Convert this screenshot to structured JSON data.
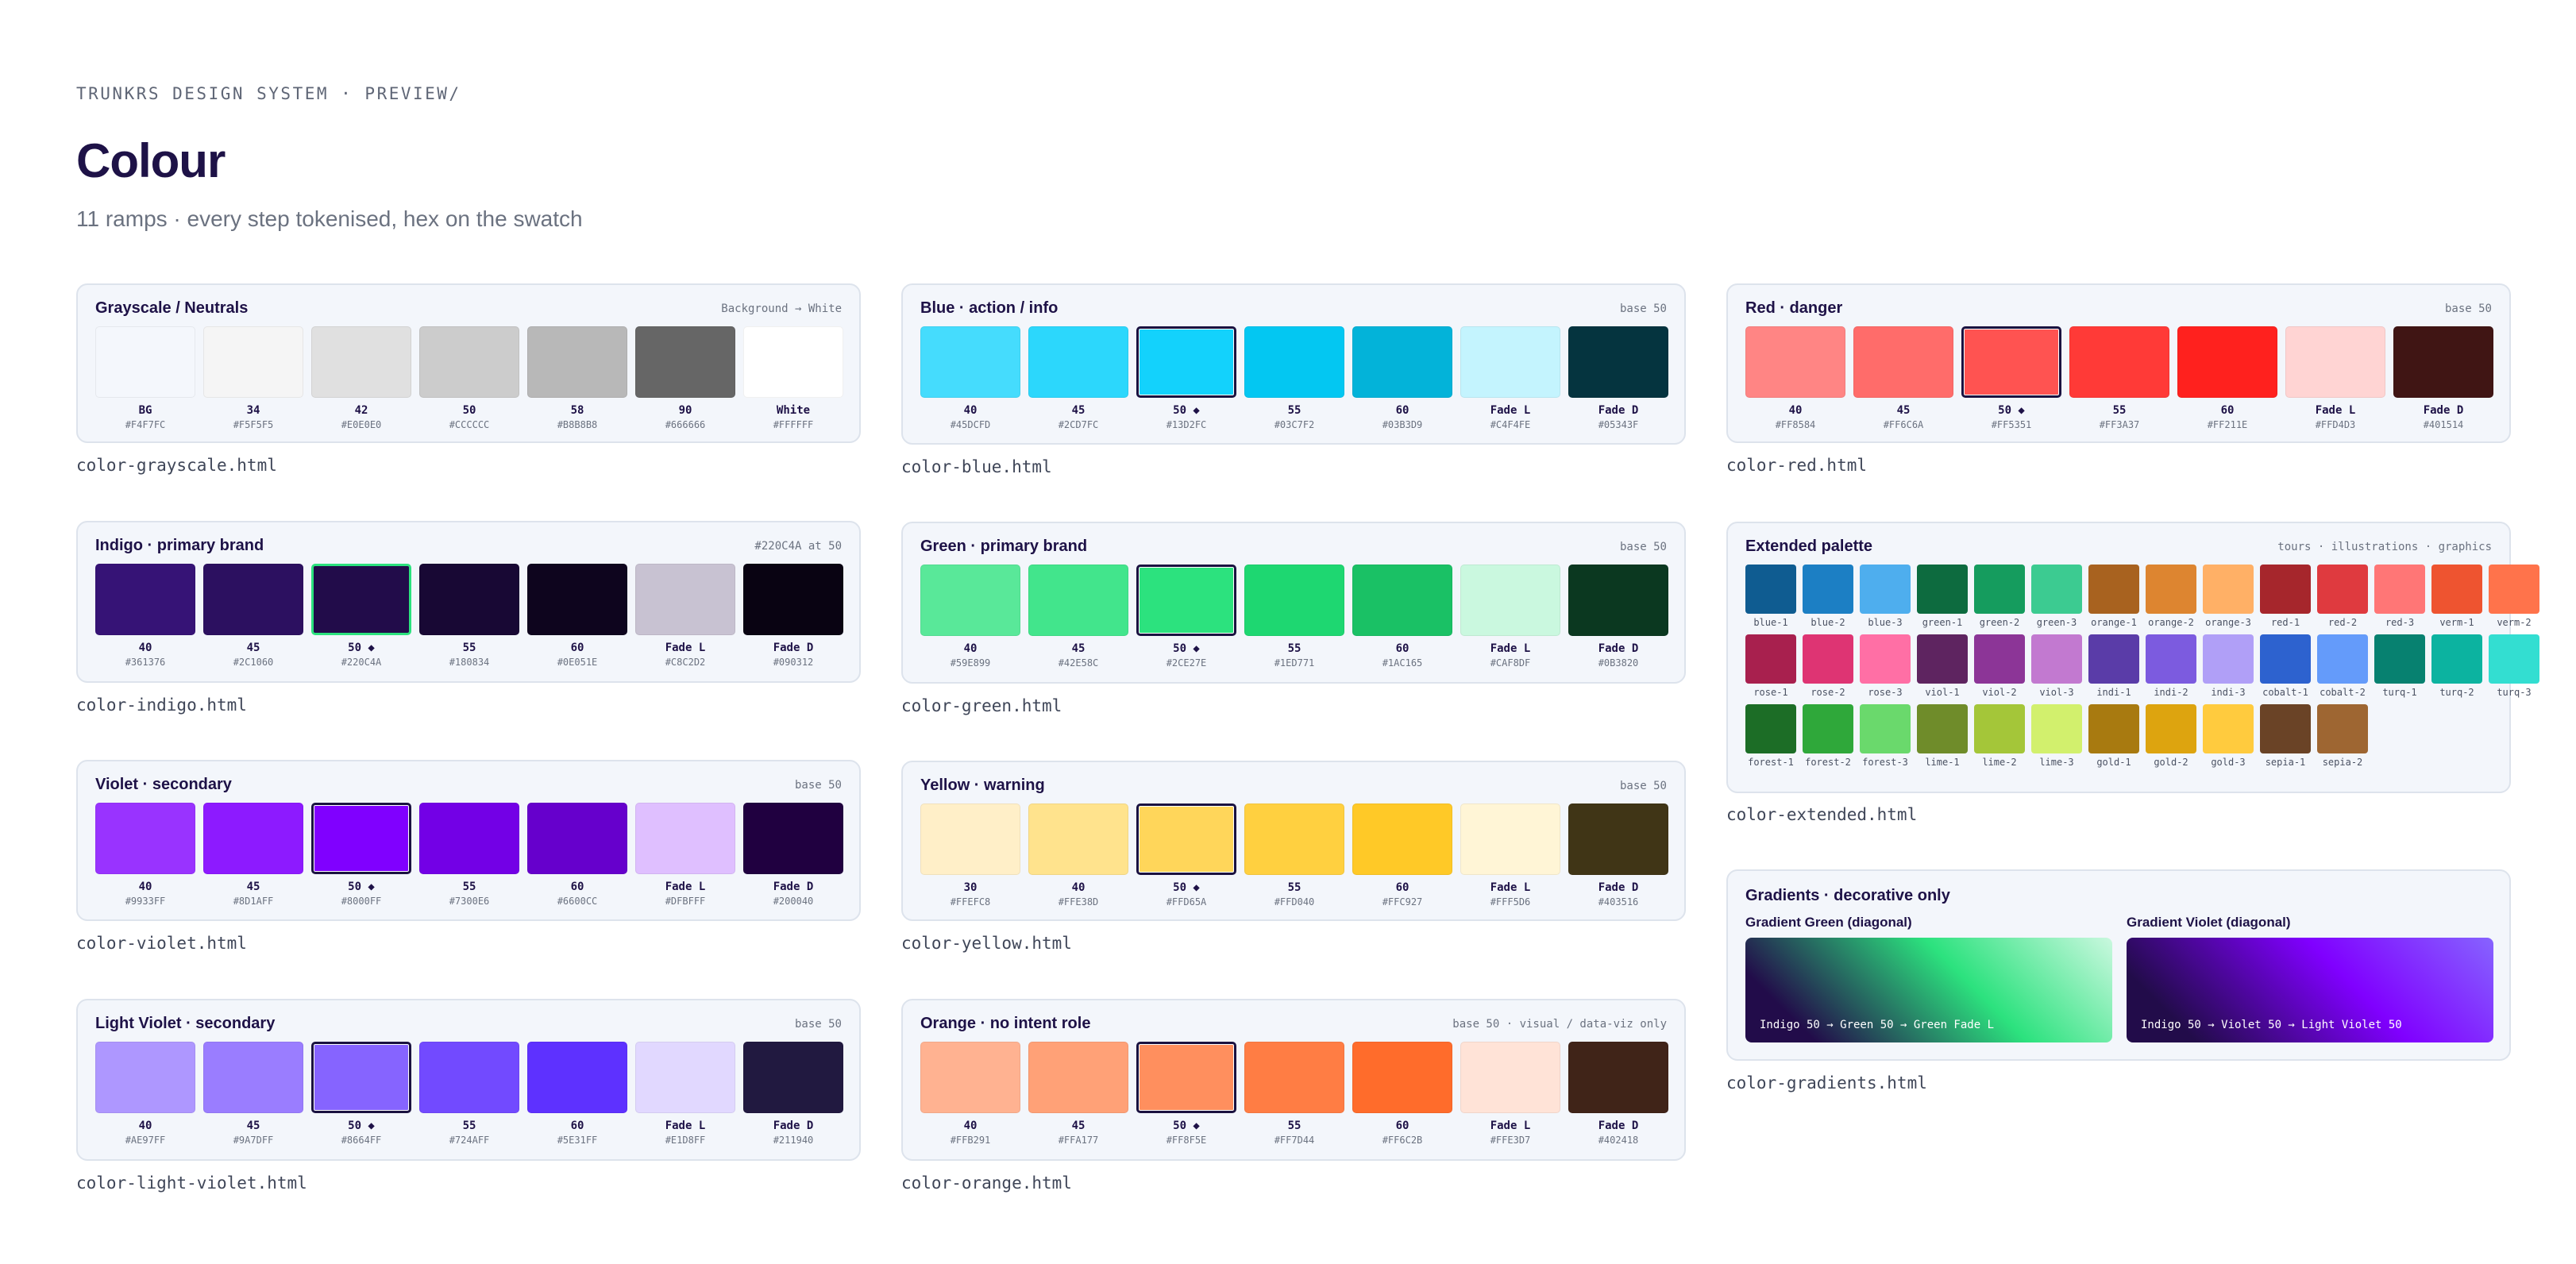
{
  "header": {
    "crumb": "TRUNKRS DESIGN SYSTEM · PREVIEW/",
    "title": "Colour",
    "subtitle": "11 ramps · every step tokenised, hex on the swatch"
  },
  "ramps": {
    "grayscale": {
      "title": "Grayscale / Neutrals",
      "meta": "Background → White",
      "file": "color-grayscale.html",
      "swatches": [
        {
          "label": "BG",
          "hex": "#F4F7FC"
        },
        {
          "label": "34",
          "hex": "#F5F5F5"
        },
        {
          "label": "42",
          "hex": "#E0E0E0"
        },
        {
          "label": "50",
          "hex": "#CCCCCC"
        },
        {
          "label": "58",
          "hex": "#B8B8B8"
        },
        {
          "label": "90",
          "hex": "#666666"
        },
        {
          "label": "White",
          "hex": "#FFFFFF"
        }
      ]
    },
    "blue": {
      "title": "Blue · action / info",
      "meta": "base 50",
      "file": "color-blue.html",
      "swatches": [
        {
          "label": "40",
          "hex": "#45DCFD"
        },
        {
          "label": "45",
          "hex": "#2CD7FC"
        },
        {
          "label": "50 ◆",
          "hex": "#13D2FC"
        },
        {
          "label": "55",
          "hex": "#03C7F2"
        },
        {
          "label": "60",
          "hex": "#03B3D9"
        },
        {
          "label": "Fade L",
          "hex": "#C4F4FE"
        },
        {
          "label": "Fade D",
          "hex": "#05343F"
        }
      ]
    },
    "red": {
      "title": "Red · danger",
      "meta": "base 50",
      "file": "color-red.html",
      "swatches": [
        {
          "label": "40",
          "hex": "#FF8584"
        },
        {
          "label": "45",
          "hex": "#FF6C6A"
        },
        {
          "label": "50 ◆",
          "hex": "#FF5351"
        },
        {
          "label": "55",
          "hex": "#FF3A37"
        },
        {
          "label": "60",
          "hex": "#FF211E"
        },
        {
          "label": "Fade L",
          "hex": "#FFD4D3"
        },
        {
          "label": "Fade D",
          "hex": "#401514"
        }
      ]
    },
    "indigo": {
      "title": "Indigo · primary brand",
      "meta": "#220C4A at 50",
      "file": "color-indigo.html",
      "swatches": [
        {
          "label": "40",
          "hex": "#361376"
        },
        {
          "label": "45",
          "hex": "#2C1060"
        },
        {
          "label": "50 ◆",
          "hex": "#220C4A"
        },
        {
          "label": "55",
          "hex": "#180834"
        },
        {
          "label": "60",
          "hex": "#0E051E"
        },
        {
          "label": "Fade L",
          "hex": "#C8C2D2"
        },
        {
          "label": "Fade D",
          "hex": "#090312"
        }
      ]
    },
    "green": {
      "title": "Green · primary brand",
      "meta": "base 50",
      "file": "color-green.html",
      "swatches": [
        {
          "label": "40",
          "hex": "#59E899"
        },
        {
          "label": "45",
          "hex": "#42E58C"
        },
        {
          "label": "50 ◆",
          "hex": "#2CE27E"
        },
        {
          "label": "55",
          "hex": "#1ED771"
        },
        {
          "label": "60",
          "hex": "#1AC165"
        },
        {
          "label": "Fade L",
          "hex": "#CAF8DF"
        },
        {
          "label": "Fade D",
          "hex": "#0B3820"
        }
      ]
    },
    "violet": {
      "title": "Violet · secondary",
      "meta": "base 50",
      "file": "color-violet.html",
      "swatches": [
        {
          "label": "40",
          "hex": "#9933FF"
        },
        {
          "label": "45",
          "hex": "#8D1AFF"
        },
        {
          "label": "50 ◆",
          "hex": "#8000FF"
        },
        {
          "label": "55",
          "hex": "#7300E6"
        },
        {
          "label": "60",
          "hex": "#6600CC"
        },
        {
          "label": "Fade L",
          "hex": "#DFBFFF"
        },
        {
          "label": "Fade D",
          "hex": "#200040"
        }
      ]
    },
    "yellow": {
      "title": "Yellow · warning",
      "meta": "base 50",
      "file": "color-yellow.html",
      "swatches": [
        {
          "label": "30",
          "hex": "#FFEFC8"
        },
        {
          "label": "40",
          "hex": "#FFE38D"
        },
        {
          "label": "50 ◆",
          "hex": "#FFD65A"
        },
        {
          "label": "55",
          "hex": "#FFD040"
        },
        {
          "label": "60",
          "hex": "#FFC927"
        },
        {
          "label": "Fade L",
          "hex": "#FFF5D6"
        },
        {
          "label": "Fade D",
          "hex": "#403516"
        }
      ]
    },
    "light_violet": {
      "title": "Light Violet · secondary",
      "meta": "base 50",
      "file": "color-light-violet.html",
      "swatches": [
        {
          "label": "40",
          "hex": "#AE97FF"
        },
        {
          "label": "45",
          "hex": "#9A7DFF"
        },
        {
          "label": "50 ◆",
          "hex": "#8664FF"
        },
        {
          "label": "55",
          "hex": "#724AFF"
        },
        {
          "label": "60",
          "hex": "#5E31FF"
        },
        {
          "label": "Fade L",
          "hex": "#E1D8FF"
        },
        {
          "label": "Fade D",
          "hex": "#211940"
        }
      ]
    },
    "orange": {
      "title": "Orange · no intent role",
      "meta": "base 50 · visual / data-viz only",
      "file": "color-orange.html",
      "swatches": [
        {
          "label": "40",
          "hex": "#FFB291"
        },
        {
          "label": "45",
          "hex": "#FFA177"
        },
        {
          "label": "50 ◆",
          "hex": "#FF8F5E"
        },
        {
          "label": "55",
          "hex": "#FF7D44"
        },
        {
          "label": "60",
          "hex": "#FF6C2B"
        },
        {
          "label": "Fade L",
          "hex": "#FFE3D7"
        },
        {
          "label": "Fade D",
          "hex": "#402418"
        }
      ]
    }
  },
  "extended": {
    "title": "Extended palette",
    "meta": "tours · illustrations · graphics",
    "file": "color-extended.html",
    "swatches": [
      {
        "label": "blue-1",
        "color": "#0F5C91"
      },
      {
        "label": "blue-2",
        "color": "#1C7FC4"
      },
      {
        "label": "blue-3",
        "color": "#4EAEEE"
      },
      {
        "label": "green-1",
        "color": "#0D6B3F"
      },
      {
        "label": "green-2",
        "color": "#159C5E"
      },
      {
        "label": "green-3",
        "color": "#3CCB91"
      },
      {
        "label": "orange-1",
        "color": "#A8621F"
      },
      {
        "label": "orange-2",
        "color": "#DD8530"
      },
      {
        "label": "orange-3",
        "color": "#FFB066"
      },
      {
        "label": "red-1",
        "color": "#A6262C"
      },
      {
        "label": "red-2",
        "color": "#DF3A3F"
      },
      {
        "label": "red-3",
        "color": "#FF7676"
      },
      {
        "label": "verm-1",
        "color": "#EE5430"
      },
      {
        "label": "verm-2",
        "color": "#FF734B"
      },
      {
        "label": "rose-1",
        "color": "#A8204E"
      },
      {
        "label": "rose-2",
        "color": "#DE3473"
      },
      {
        "label": "rose-3",
        "color": "#FF6FA5"
      },
      {
        "label": "viol-1",
        "color": "#5E2460"
      },
      {
        "label": "viol-2",
        "color": "#8C3597"
      },
      {
        "label": "viol-3",
        "color": "#C279D0"
      },
      {
        "label": "indi-1",
        "color": "#5A3CA8"
      },
      {
        "label": "indi-2",
        "color": "#7C5BDF"
      },
      {
        "label": "indi-3",
        "color": "#B09FF7"
      },
      {
        "label": "cobalt-1",
        "color": "#2D62CF"
      },
      {
        "label": "cobalt-2",
        "color": "#649BFA"
      },
      {
        "label": "turq-1",
        "color": "#078170"
      },
      {
        "label": "turq-2",
        "color": "#0CB3A0"
      },
      {
        "label": "turq-3",
        "color": "#33DED1"
      },
      {
        "label": "forest-1",
        "color": "#1C6D26"
      },
      {
        "label": "forest-2",
        "color": "#2FA83A"
      },
      {
        "label": "forest-3",
        "color": "#6AD96C"
      },
      {
        "label": "lime-1",
        "color": "#6F8C2A"
      },
      {
        "label": "lime-2",
        "color": "#A4C639"
      },
      {
        "label": "lime-3",
        "color": "#D2F06D"
      },
      {
        "label": "gold-1",
        "color": "#A87A10"
      },
      {
        "label": "gold-2",
        "color": "#DDA40F"
      },
      {
        "label": "gold-3",
        "color": "#FFCB3E"
      },
      {
        "label": "sepia-1",
        "color": "#6A4326"
      },
      {
        "label": "sepia-2",
        "color": "#9E6632"
      }
    ]
  },
  "gradients": {
    "title": "Gradients · decorative only",
    "file": "color-gradients.html",
    "green": {
      "title": "Gradient Green (diagonal)",
      "caption": "Indigo 50 → Green 50 → Green Fade L",
      "stops": [
        "#220C4A",
        "#2CE27E",
        "#CAF8DF"
      ]
    },
    "violet": {
      "title": "Gradient Violet (diagonal)",
      "caption": "Indigo 50 → Violet 50 → Light Violet 50",
      "stops": [
        "#220C4A",
        "#8000FF",
        "#8664FF"
      ]
    }
  }
}
